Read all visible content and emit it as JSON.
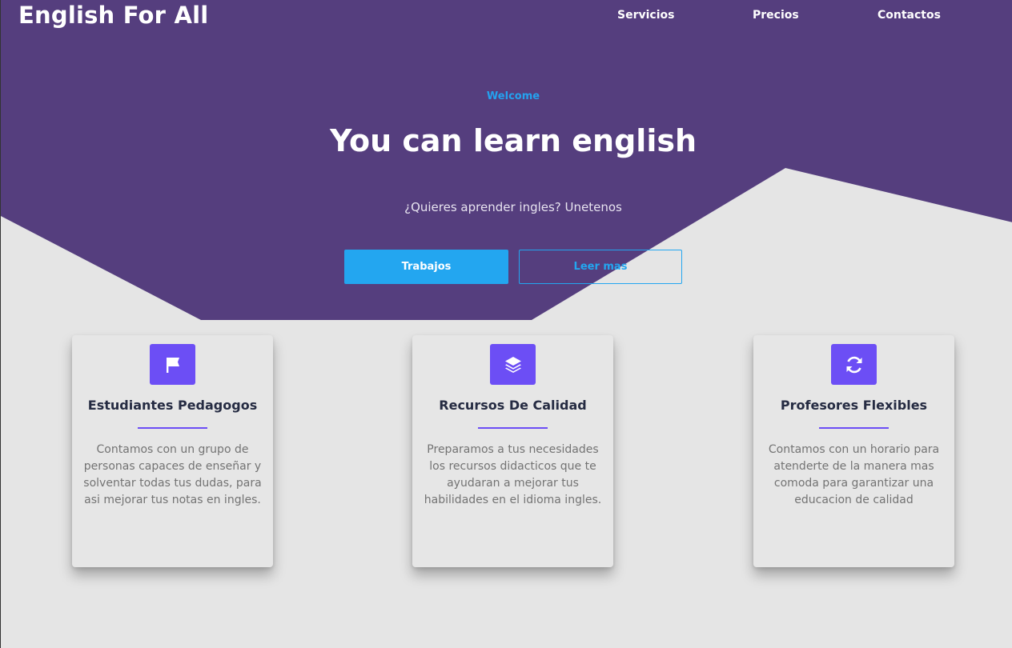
{
  "nav": {
    "brand": "English For All",
    "links": [
      "Servicios",
      "Precios",
      "Contactos"
    ]
  },
  "hero": {
    "eyebrow": "Welcome",
    "title": "You can learn english",
    "subtitle": "¿Quieres aprender ingles? Unetenos",
    "primary_button": "Trabajos",
    "secondary_button": "Leer mas"
  },
  "features": [
    {
      "icon": "flag-icon",
      "title": "Estudiantes Pedagogos",
      "text": "Contamos con un grupo de personas capaces de enseñar y solventar todas tus dudas, para asi mejorar tus notas en ingles."
    },
    {
      "icon": "layers-icon",
      "title": "Recursos De Calidad",
      "text": "Preparamos a tus necesidades los recursos didacticos que te ayudaran a mejorar tus habilidades en el idioma ingles."
    },
    {
      "icon": "refresh-icon",
      "title": "Profesores Flexibles",
      "text": "Contamos con un horario para atenderte de la manera mas comoda para garantizar una educacion de calidad"
    }
  ],
  "colors": {
    "hero_background": "#553e7e",
    "page_background": "#e5e5e5",
    "accent_blue": "#23a6f0",
    "icon_purple": "#6c4ef5",
    "heading_dark": "#252b42",
    "body_gray": "#737373"
  }
}
